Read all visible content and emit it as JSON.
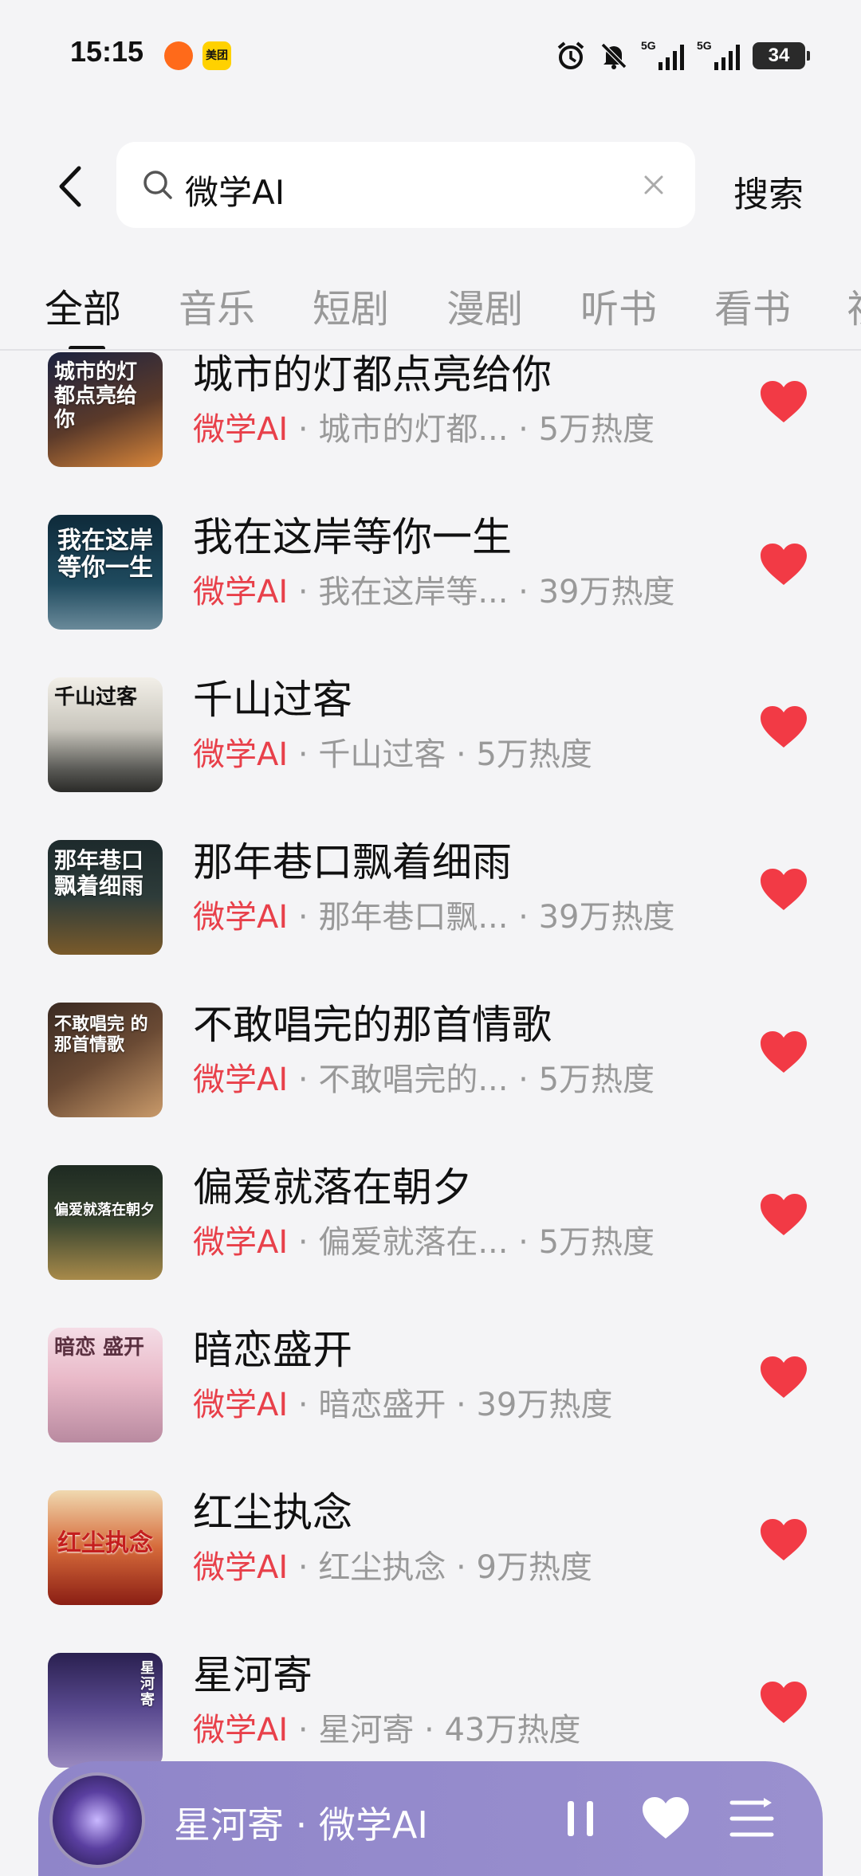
{
  "status_bar": {
    "time": "15:15",
    "app2_label": "美团",
    "battery": "34"
  },
  "search": {
    "query": "微学AI",
    "submit_label": "搜索"
  },
  "tabs": [
    {
      "label": "全部",
      "active": true
    },
    {
      "label": "音乐",
      "active": false
    },
    {
      "label": "短剧",
      "active": false
    },
    {
      "label": "漫剧",
      "active": false
    },
    {
      "label": "听书",
      "active": false
    },
    {
      "label": "看书",
      "active": false
    },
    {
      "label": "视",
      "active": false
    }
  ],
  "songs": [
    {
      "title": "城市的灯都点亮给你",
      "artist": "微学AI",
      "meta": " · 城市的灯都...  · 5万热度",
      "cover_text": "城市的灯 都点亮给你"
    },
    {
      "title": "我在这岸等你一生",
      "artist": "微学AI",
      "meta": " · 我在这岸等... · 39万热度",
      "cover_text": "我在这岸 等你一生"
    },
    {
      "title": "千山过客",
      "artist": "微学AI",
      "meta": " · 千山过客 · 5万热度",
      "cover_text": "千山过客"
    },
    {
      "title": "那年巷口飘着细雨",
      "artist": "微学AI",
      "meta": " · 那年巷口飘... · 39万热度",
      "cover_text": "那年巷口 飘着细雨"
    },
    {
      "title": "不敢唱完的那首情歌",
      "artist": "微学AI",
      "meta": " · 不敢唱完的...  · 5万热度",
      "cover_text": "不敢唱完 的那首情歌"
    },
    {
      "title": "偏爱就落在朝夕",
      "artist": "微学AI",
      "meta": " · 偏爱就落在...  · 5万热度",
      "cover_text": "偏爱就落在朝夕"
    },
    {
      "title": "暗恋盛开",
      "artist": "微学AI",
      "meta": " · 暗恋盛开 · 39万热度",
      "cover_text": "暗恋 盛开"
    },
    {
      "title": "红尘执念",
      "artist": "微学AI",
      "meta": " · 红尘执念 · 9万热度",
      "cover_text": "红尘执念"
    },
    {
      "title": "星河寄",
      "artist": "微学AI",
      "meta": " · 星河寄 · 43万热度",
      "cover_text": "星河寄"
    }
  ],
  "player": {
    "now_playing": "星河寄 · 微学AI"
  },
  "colors": {
    "accent_red": "#e8404a",
    "heart_red": "#f23a45",
    "player_bg": "#958bcc"
  }
}
